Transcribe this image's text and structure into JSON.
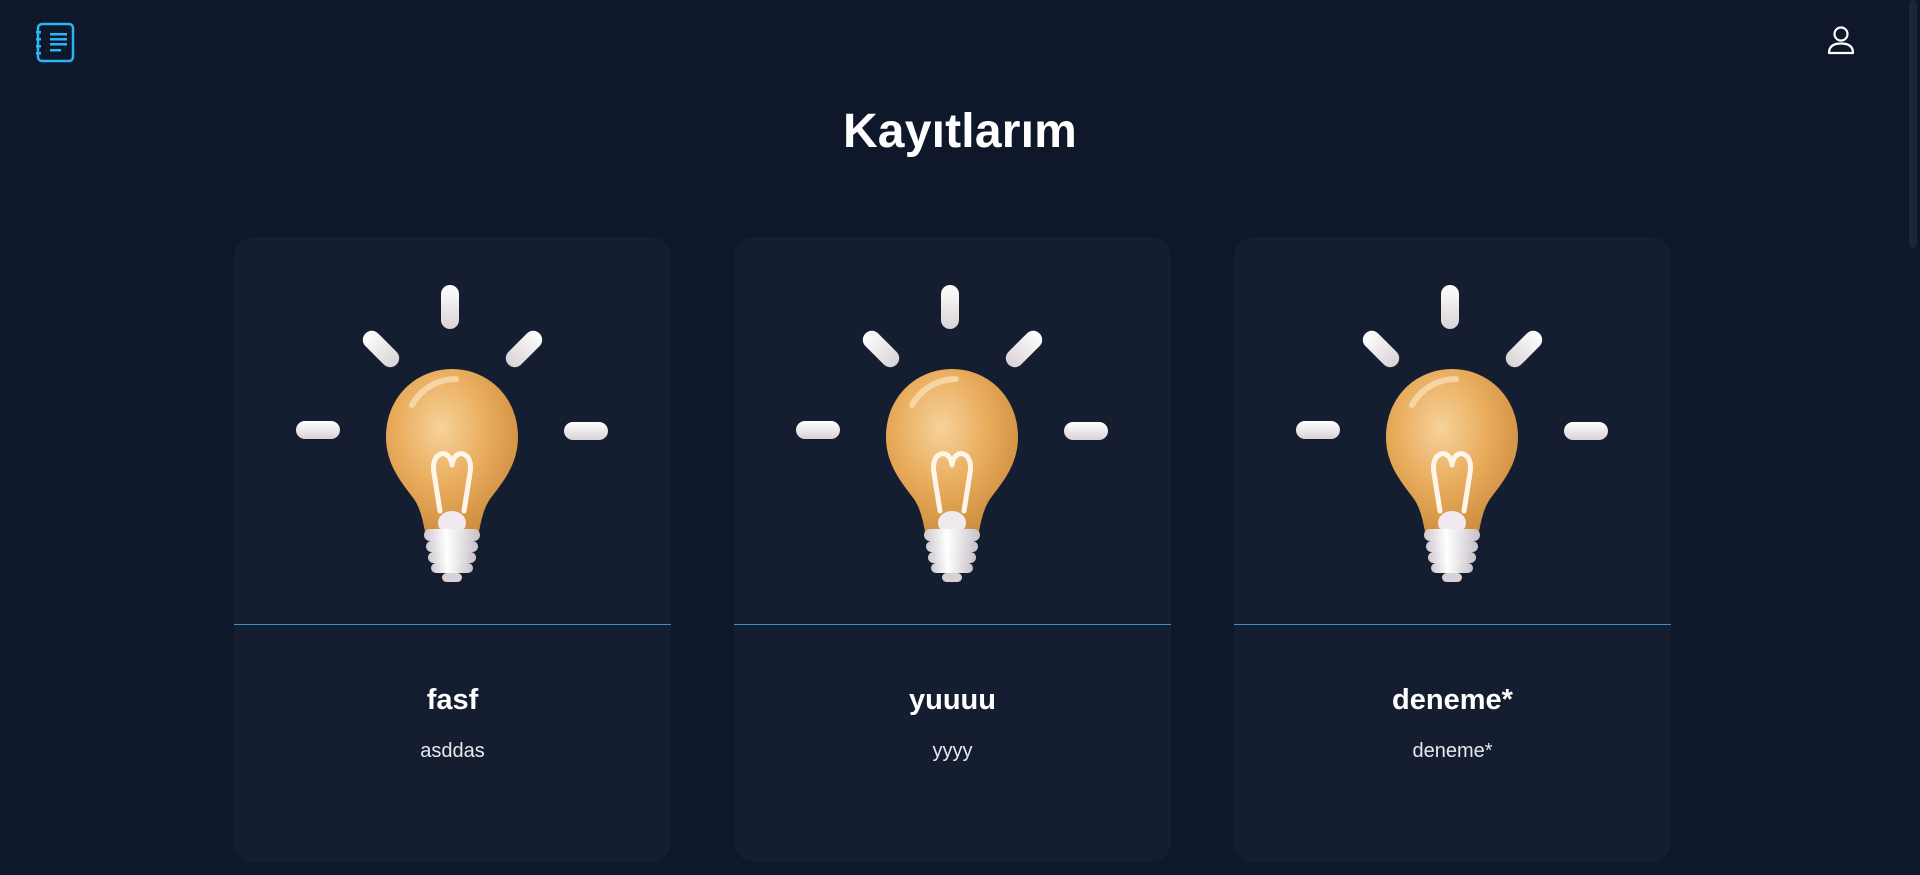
{
  "header": {
    "logo_icon": "notebook-list-icon",
    "user_icon": "user-icon",
    "accent_color": "#29b6f6"
  },
  "page": {
    "title": "Kayıtlarım"
  },
  "cards": [
    {
      "title": "fasf",
      "description": "asddas",
      "image_icon": "lightbulb-icon"
    },
    {
      "title": "yuuuu",
      "description": "yyyy",
      "image_icon": "lightbulb-icon"
    },
    {
      "title": "deneme*",
      "description": "deneme*",
      "image_icon": "lightbulb-icon"
    }
  ]
}
